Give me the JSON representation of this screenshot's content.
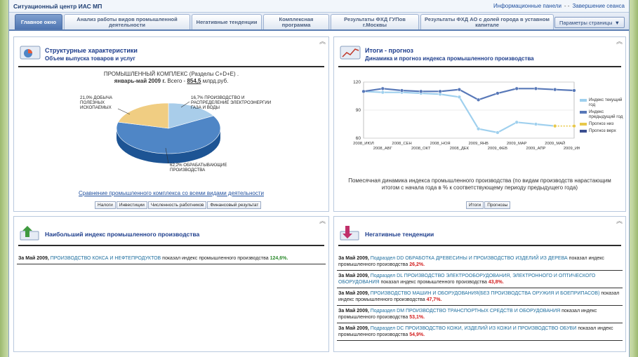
{
  "app_title": "Ситуационный центр ИАС МП",
  "top_links": {
    "info_panels": "Информационные панели",
    "separator": "- -",
    "end_session": "Завершение сеанса"
  },
  "tabs": [
    {
      "label": "Главное окно",
      "active": true
    },
    {
      "label": "Анализ работы видов промышленной деятельности",
      "active": false
    },
    {
      "label": "Негативные тенденции",
      "active": false
    },
    {
      "label": "Комплексная программа",
      "active": false
    },
    {
      "label": "Результаты ФХД ГУПов г.Москвы",
      "active": false
    },
    {
      "label": "Результаты ФХД АО с долей города в уставном капитале",
      "active": false
    }
  ],
  "page_params_label": "Параметры страницы",
  "panel_structure": {
    "title": "Структурные характеристики",
    "subtitle": "Объем выпуска товаров и услуг",
    "line1": "ПРОМЫШЛЕННЫЙ КОМПЛЕКС (Разделы C+D+E) .",
    "period": "январь-май 2009 г.",
    "total_prefix": "Всего -",
    "total_value": "854,5",
    "total_unit": "млрд.руб.",
    "pie": [
      {
        "label": "62,2% ОБРАБАТЫВАЮЩИЕ ПРОИЗВОДСТВА",
        "value": 62.2,
        "color": "#4f86c6"
      },
      {
        "label": "21,0% ДОБЫЧА ПОЛЕЗНЫХ ИСКОПАЕМЫХ",
        "value": 21.0,
        "color": "#f0cd82"
      },
      {
        "label": "16,7% ПРОИЗВОДСТВО И РАСПРЕДЕЛЕНИЕ ЭЛЕКТРОЭНЕРГИИ ГАЗА И ВОДЫ",
        "value": 16.7,
        "color": "#a9cdea"
      }
    ],
    "compare_link": "Сравнение промышленного комплекса со всеми видами деятельности",
    "buttons": [
      "Налоги",
      "Инвестиции",
      "Численность работников",
      "Финансовый результат"
    ]
  },
  "panel_forecast": {
    "title": "Итоги - прогноз",
    "subtitle": "Динамика и прогноз индекса промышленного производства",
    "description": "Помесячная динамика индекса промышленного производства (по видам производств нарастающим итогом с начала года в % к соответствующему периоду предыдущего года)",
    "buttons": [
      "Итоги",
      "Прогнозы"
    ]
  },
  "chart_data": {
    "type": "line",
    "categories": [
      "2008_ИЮЛ",
      "2008_АВГ",
      "2008_СЕН",
      "2008_ОКТ",
      "2008_НОЯ",
      "2008_ДЕК",
      "2009_ЯНВ",
      "2009_ФЕВ",
      "2009_МАР",
      "2009_АПР",
      "2009_МАЙ",
      "2009_ИЮН"
    ],
    "yticks": [
      60,
      90,
      120
    ],
    "ylim": [
      60,
      120
    ],
    "series": [
      {
        "name": "Индекс текущий год",
        "color": "#9fd0ee",
        "values": [
          110,
          109,
          109,
          108,
          107,
          104,
          70,
          66,
          77,
          75,
          73,
          null
        ]
      },
      {
        "name": "Индекс предыдущий год",
        "color": "#5878b8",
        "values": [
          110,
          113,
          111,
          110,
          110,
          112,
          101,
          108,
          113,
          113,
          112,
          111
        ]
      },
      {
        "name": "Прогноз низ",
        "color": "#e8c84a",
        "values": [
          null,
          null,
          null,
          null,
          null,
          null,
          null,
          null,
          null,
          null,
          73,
          73
        ]
      },
      {
        "name": "Прогноз верх",
        "color": "#3b4f90",
        "values": [
          null,
          null,
          null,
          null,
          null,
          null,
          null,
          null,
          null,
          null,
          null,
          null
        ]
      }
    ]
  },
  "panel_top": {
    "title": "Наибольший индекс промышленного производства",
    "period": "За Май 2009,",
    "item": "ПРОИЗВОДСТВО КОКСА И НЕФТЕПРОДУКТОВ",
    "text": "показал индекс промышленного производства",
    "value": "124,6%."
  },
  "panel_negative": {
    "title": "Негативные тенденции",
    "items": [
      {
        "period": "За Май 2009,",
        "item": "Подраздел DD ОБРАБОТКА ДРЕВЕСИНЫ И ПРОИЗВОДСТВО ИЗДЕЛИЙ ИЗ ДЕРЕВА",
        "text": "показал индекс промышленного производства",
        "value": "26,2%."
      },
      {
        "period": "За Май 2009,",
        "item": "Подраздел DL ПРОИЗВОДСТВО ЭЛЕКТРООБОРУДОВАНИЯ, ЭЛЕКТРОННОГО И ОПТИЧЕСКОГО ОБОРУДОВАНИЯ",
        "text": "показал индекс промышленного производства",
        "value": "43,8%."
      },
      {
        "period": "За Май 2009,",
        "item": "ПРОИЗВОДСТВО МАШИН И ОБОРУДОВАНИЯ(БЕЗ ПРОИЗВОДСТВА ОРУЖИЯ И БОЕПРИПАСОВ)",
        "text": "показал индекс промышленного производства",
        "value": "47,7%."
      },
      {
        "period": "За Май 2009,",
        "item": "Подраздел DM ПРОИЗВОДСТВО ТРАНСПОРТНЫХ СРЕДСТВ И ОБОРУДОВАНИЯ",
        "text": "показал индекс промышленного производства",
        "value": "53,1%."
      },
      {
        "period": "За Май 2009,",
        "item": "Подраздел DC ПРОИЗВОДСТВО КОЖИ, ИЗДЕЛИЙ ИЗ КОЖИ И ПРОИЗВОДСТВО ОБУВИ",
        "text": "показал индекс промышленного производства",
        "value": "54,9%."
      }
    ]
  }
}
